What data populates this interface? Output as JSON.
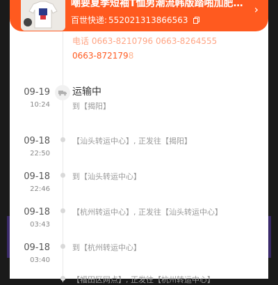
{
  "header": {
    "title": "嘲要夏季短袖T恤男潮流韩版踏啪加肥加大码",
    "courier": "百世快递:",
    "tracking": "552021313866563",
    "colors": {
      "accent": "#ff5a1f"
    }
  },
  "contact": {
    "phones_line1": "电话 0663-8210796  0663-8264555",
    "phone2_main": "0663-872179",
    "phone2_tail": "8"
  },
  "events": [
    {
      "date": "09-19",
      "time": "10:24",
      "status": "运输中",
      "location": "到【揭阳】"
    },
    {
      "date": "09-18",
      "time": "22:50",
      "location": "【汕头转运中心】, 正发往【揭阳】"
    },
    {
      "date": "09-18",
      "time": "22:46",
      "location": "到【汕头转运中心】"
    },
    {
      "date": "09-18",
      "time": "03:43",
      "location": "【杭州转运中心】, 正发往【汕头转运中心】"
    },
    {
      "date": "09-18",
      "time": "03:40",
      "location": "到【杭州转运中心】"
    },
    {
      "location": "【福田区网点】, 正发往【杭州转运中心】"
    }
  ]
}
